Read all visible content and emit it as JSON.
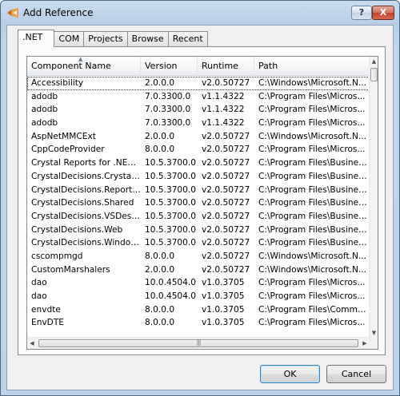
{
  "window": {
    "title": "Add Reference",
    "help_label": "?",
    "close_label": "X"
  },
  "tabs": [
    ".NET",
    "COM",
    "Projects",
    "Browse",
    "Recent"
  ],
  "columns": [
    "Component Name",
    "Version",
    "Runtime",
    "Path"
  ],
  "rows": [
    [
      "Accessibility",
      "2.0.0.0",
      "v2.0.50727",
      "C:\\Windows\\Microsoft.N..."
    ],
    [
      "adodb",
      "7.0.3300.0",
      "v1.1.4322",
      "C:\\Program Files\\Micros..."
    ],
    [
      "adodb",
      "7.0.3300.0",
      "v1.1.4322",
      "C:\\Program Files\\Micros..."
    ],
    [
      "adodb",
      "7.0.3300.0",
      "v1.1.4322",
      "C:\\Program Files\\Micros..."
    ],
    [
      "AspNetMMCExt",
      "2.0.0.0",
      "v2.0.50727",
      "C:\\Windows\\Microsoft.N..."
    ],
    [
      "CppCodeProvider",
      "8.0.0.0",
      "v2.0.50727",
      "C:\\Program Files\\Micros..."
    ],
    [
      "Crystal Reports for .NET Fr...",
      "10.5.3700.0",
      "v2.0.50727",
      "C:\\Program Files\\Busines..."
    ],
    [
      "CrystalDecisions.CrystalRe...",
      "10.5.3700.0",
      "v2.0.50727",
      "C:\\Program Files\\Busines..."
    ],
    [
      "CrystalDecisions.ReportSo...",
      "10.5.3700.0",
      "v2.0.50727",
      "C:\\Program Files\\Busines..."
    ],
    [
      "CrystalDecisions.Shared",
      "10.5.3700.0",
      "v2.0.50727",
      "C:\\Program Files\\Busines..."
    ],
    [
      "CrystalDecisions.VSDesigner",
      "10.5.3700.0",
      "v2.0.50727",
      "C:\\Program Files\\Busines..."
    ],
    [
      "CrystalDecisions.Web",
      "10.5.3700.0",
      "v2.0.50727",
      "C:\\Program Files\\Busines..."
    ],
    [
      "CrystalDecisions.Windows....",
      "10.5.3700.0",
      "v2.0.50727",
      "C:\\Program Files\\Busines..."
    ],
    [
      "cscompmgd",
      "8.0.0.0",
      "v2.0.50727",
      "C:\\Windows\\Microsoft.N..."
    ],
    [
      "CustomMarshalers",
      "2.0.0.0",
      "v2.0.50727",
      "C:\\Windows\\Microsoft.N..."
    ],
    [
      "dao",
      "10.0.4504.0",
      "v1.0.3705",
      "C:\\Program Files\\Micros..."
    ],
    [
      "dao",
      "10.0.4504.0",
      "v1.0.3705",
      "C:\\Program Files\\Micros..."
    ],
    [
      "envdte",
      "8.0.0.0",
      "v1.0.3705",
      "C:\\Program Files\\Commo..."
    ],
    [
      "EnvDTE",
      "8.0.0.0",
      "v1.0.3705",
      "C:\\Program Files\\Micros..."
    ]
  ],
  "selected_row": 0,
  "buttons": {
    "ok": "OK",
    "cancel": "Cancel"
  },
  "icons": {
    "app": "visual-studio-icon",
    "sort": "sort-ascending-icon",
    "scroll_up": "up-arrow-icon",
    "scroll_down": "down-arrow-icon",
    "scroll_left": "left-arrow-icon",
    "scroll_right": "right-arrow-icon"
  },
  "colors": {
    "title_bar": "#c2d6ea",
    "close_button": "#c0442b",
    "ok_border": "#3c7fb1"
  }
}
